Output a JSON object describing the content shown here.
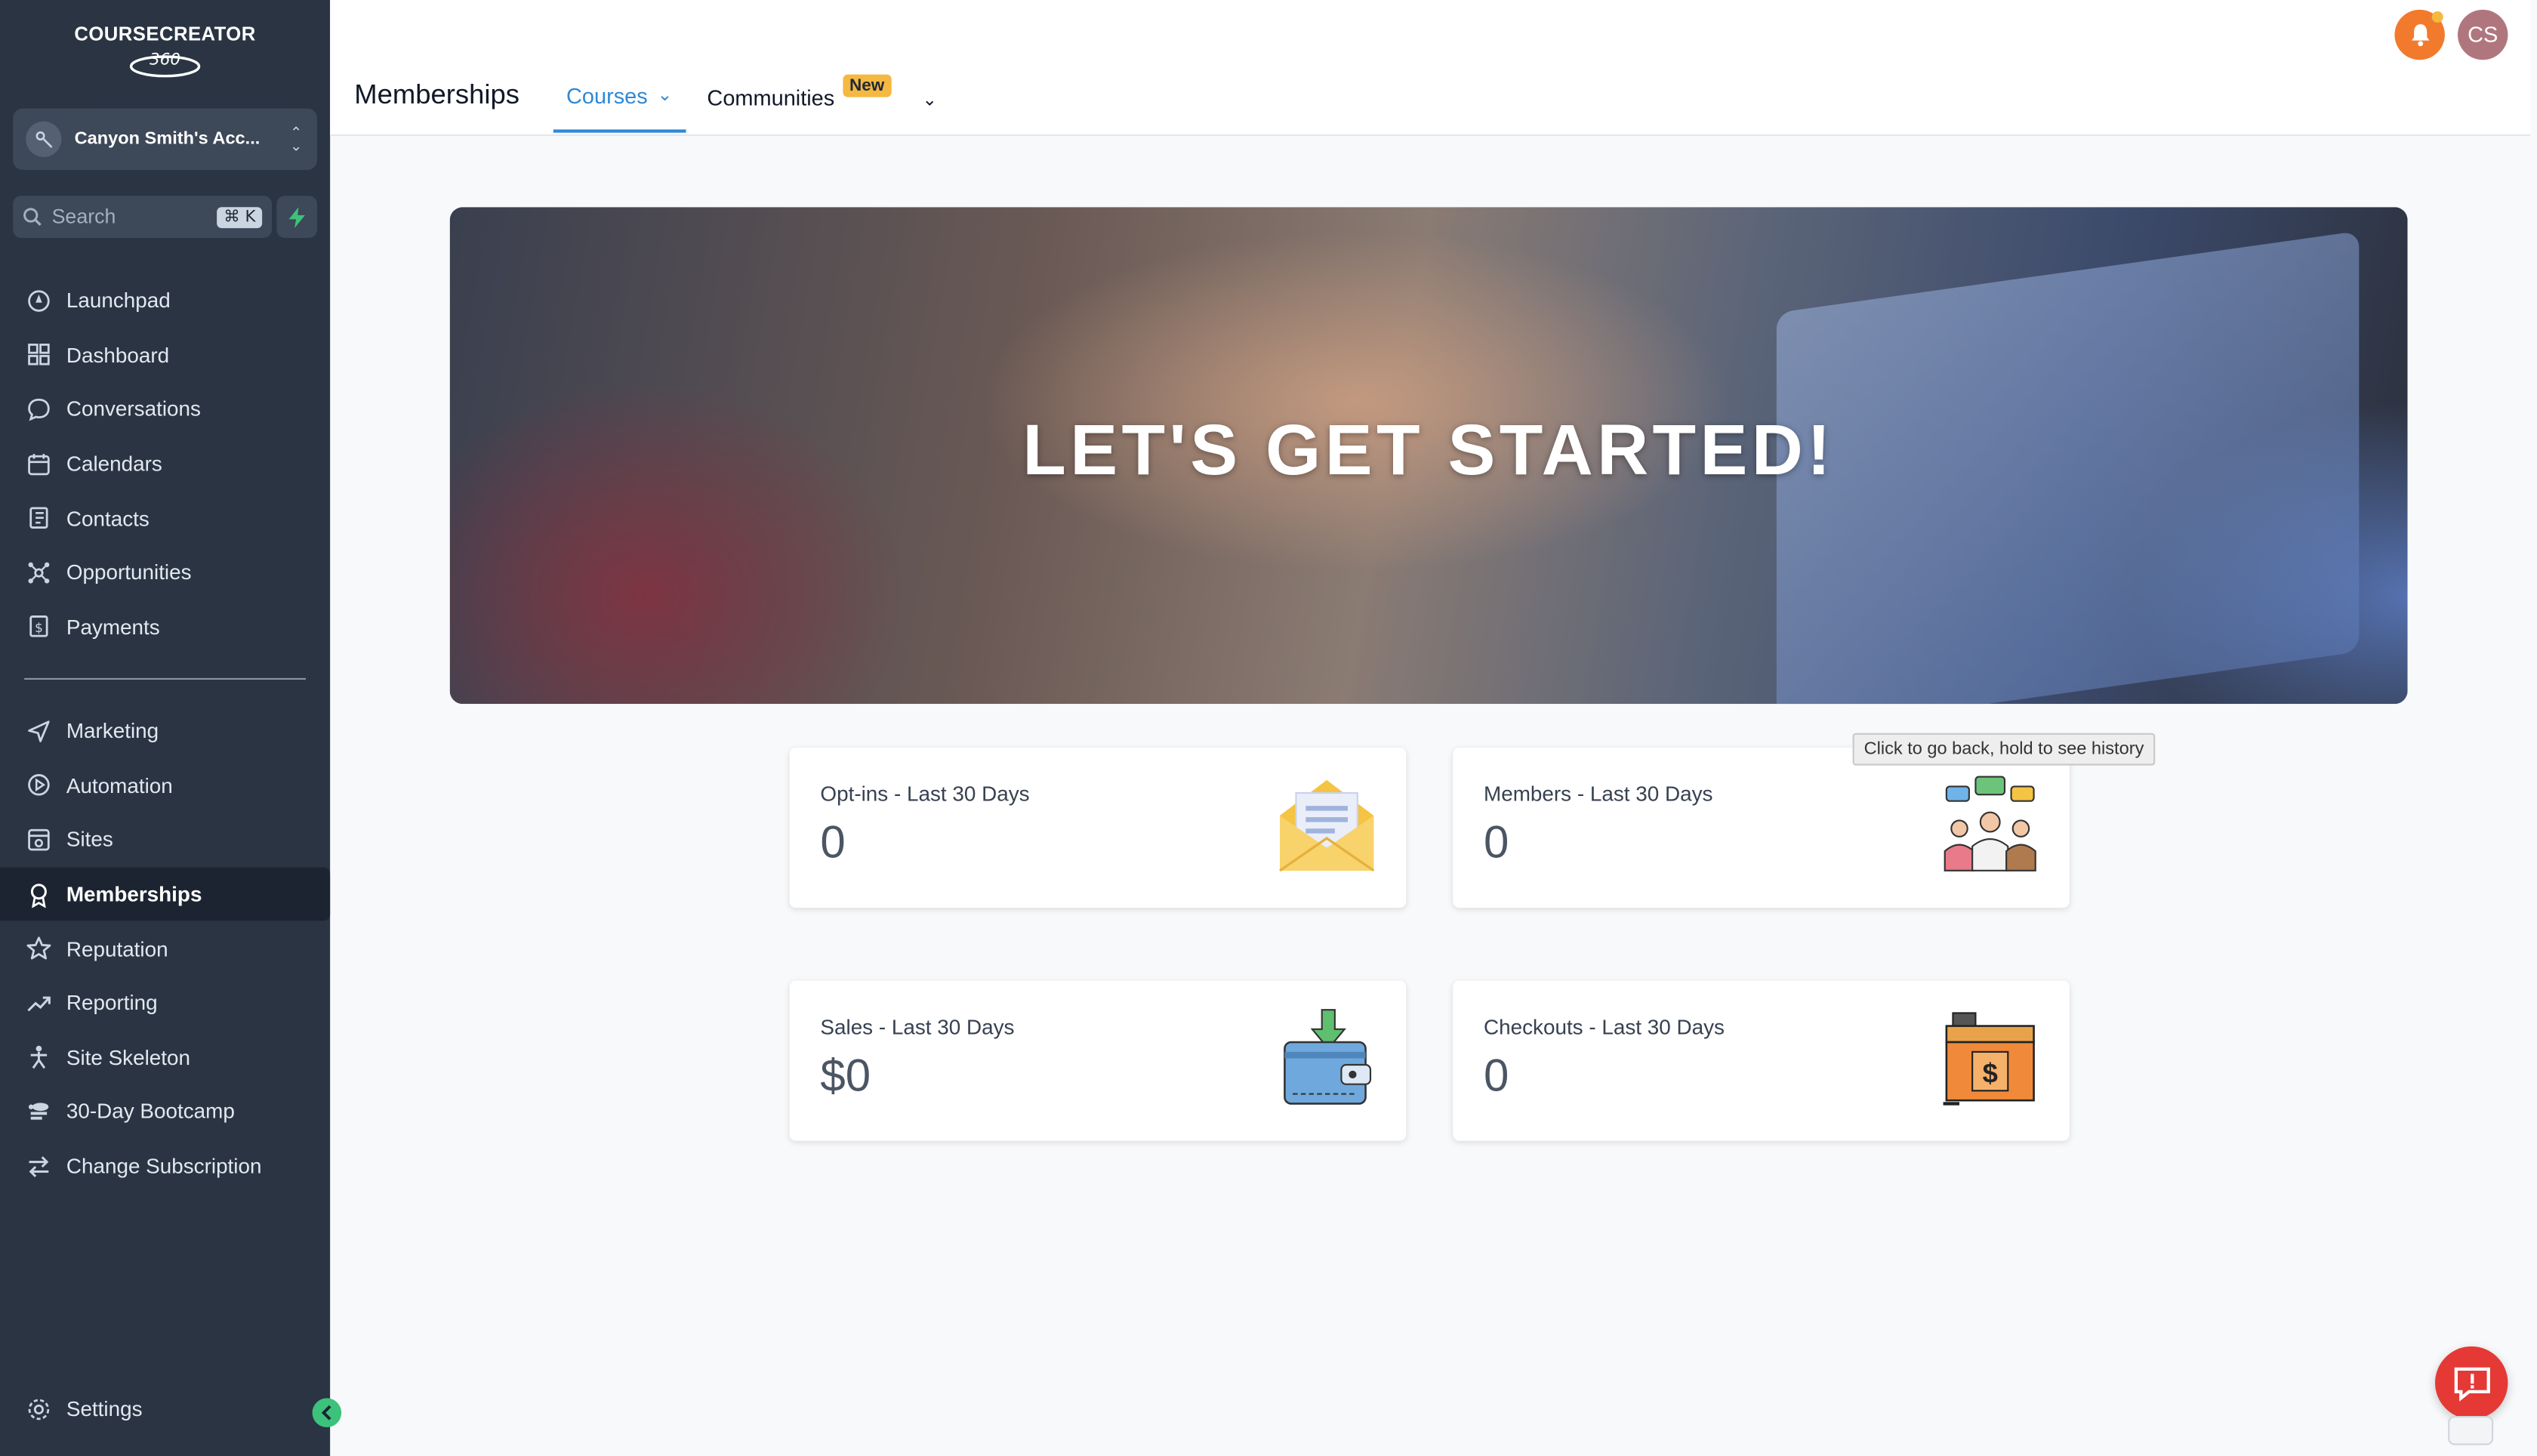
{
  "brand": {
    "logo_text": "COURSECREATOR",
    "logo_sub": "360"
  },
  "account": {
    "name": "Canyon Smith's Acc..."
  },
  "search": {
    "label": "Search",
    "shortcut": "⌘ K"
  },
  "sidebar": {
    "primary": [
      {
        "label": "Launchpad",
        "icon": "launchpad-icon"
      },
      {
        "label": "Dashboard",
        "icon": "dashboard-icon"
      },
      {
        "label": "Conversations",
        "icon": "chat-icon"
      },
      {
        "label": "Calendars",
        "icon": "calendar-icon"
      },
      {
        "label": "Contacts",
        "icon": "contacts-icon"
      },
      {
        "label": "Opportunities",
        "icon": "opportunities-icon"
      },
      {
        "label": "Payments",
        "icon": "payments-icon"
      }
    ],
    "secondary": [
      {
        "label": "Marketing",
        "icon": "send-icon"
      },
      {
        "label": "Automation",
        "icon": "automation-icon"
      },
      {
        "label": "Sites",
        "icon": "sites-icon"
      },
      {
        "label": "Memberships",
        "icon": "memberships-icon",
        "active": true
      },
      {
        "label": "Reputation",
        "icon": "star-icon"
      },
      {
        "label": "Reporting",
        "icon": "trend-icon"
      },
      {
        "label": "Site Skeleton",
        "icon": "skeleton-icon"
      },
      {
        "label": "30-Day Bootcamp",
        "icon": "bootcamp-icon"
      },
      {
        "label": "Change Subscription",
        "icon": "swap-icon"
      }
    ],
    "settings_label": "Settings"
  },
  "header": {
    "title": "Memberships",
    "tabs": [
      {
        "label": "Courses",
        "active": true
      },
      {
        "label": "Communities",
        "badge": "New"
      }
    ],
    "user_initials": "CS"
  },
  "hero": {
    "title": "LET'S GET STARTED!"
  },
  "stats": [
    {
      "label": "Opt-ins - Last 30 Days",
      "value": "0",
      "icon": "envelope-icon"
    },
    {
      "label": "Members - Last 30 Days",
      "value": "0",
      "icon": "members-icon"
    },
    {
      "label": "Sales - Last 30 Days",
      "value": "$0",
      "icon": "wallet-icon"
    },
    {
      "label": "Checkouts - Last 30 Days",
      "value": "0",
      "icon": "register-icon"
    }
  ],
  "tooltip": {
    "text": "Click to go back, hold to see history"
  },
  "colors": {
    "sidebar": "#2a3443",
    "accent": "#2f89d6",
    "badge": "#f5b841",
    "bell": "#f27a2c",
    "help": "#e53935"
  }
}
